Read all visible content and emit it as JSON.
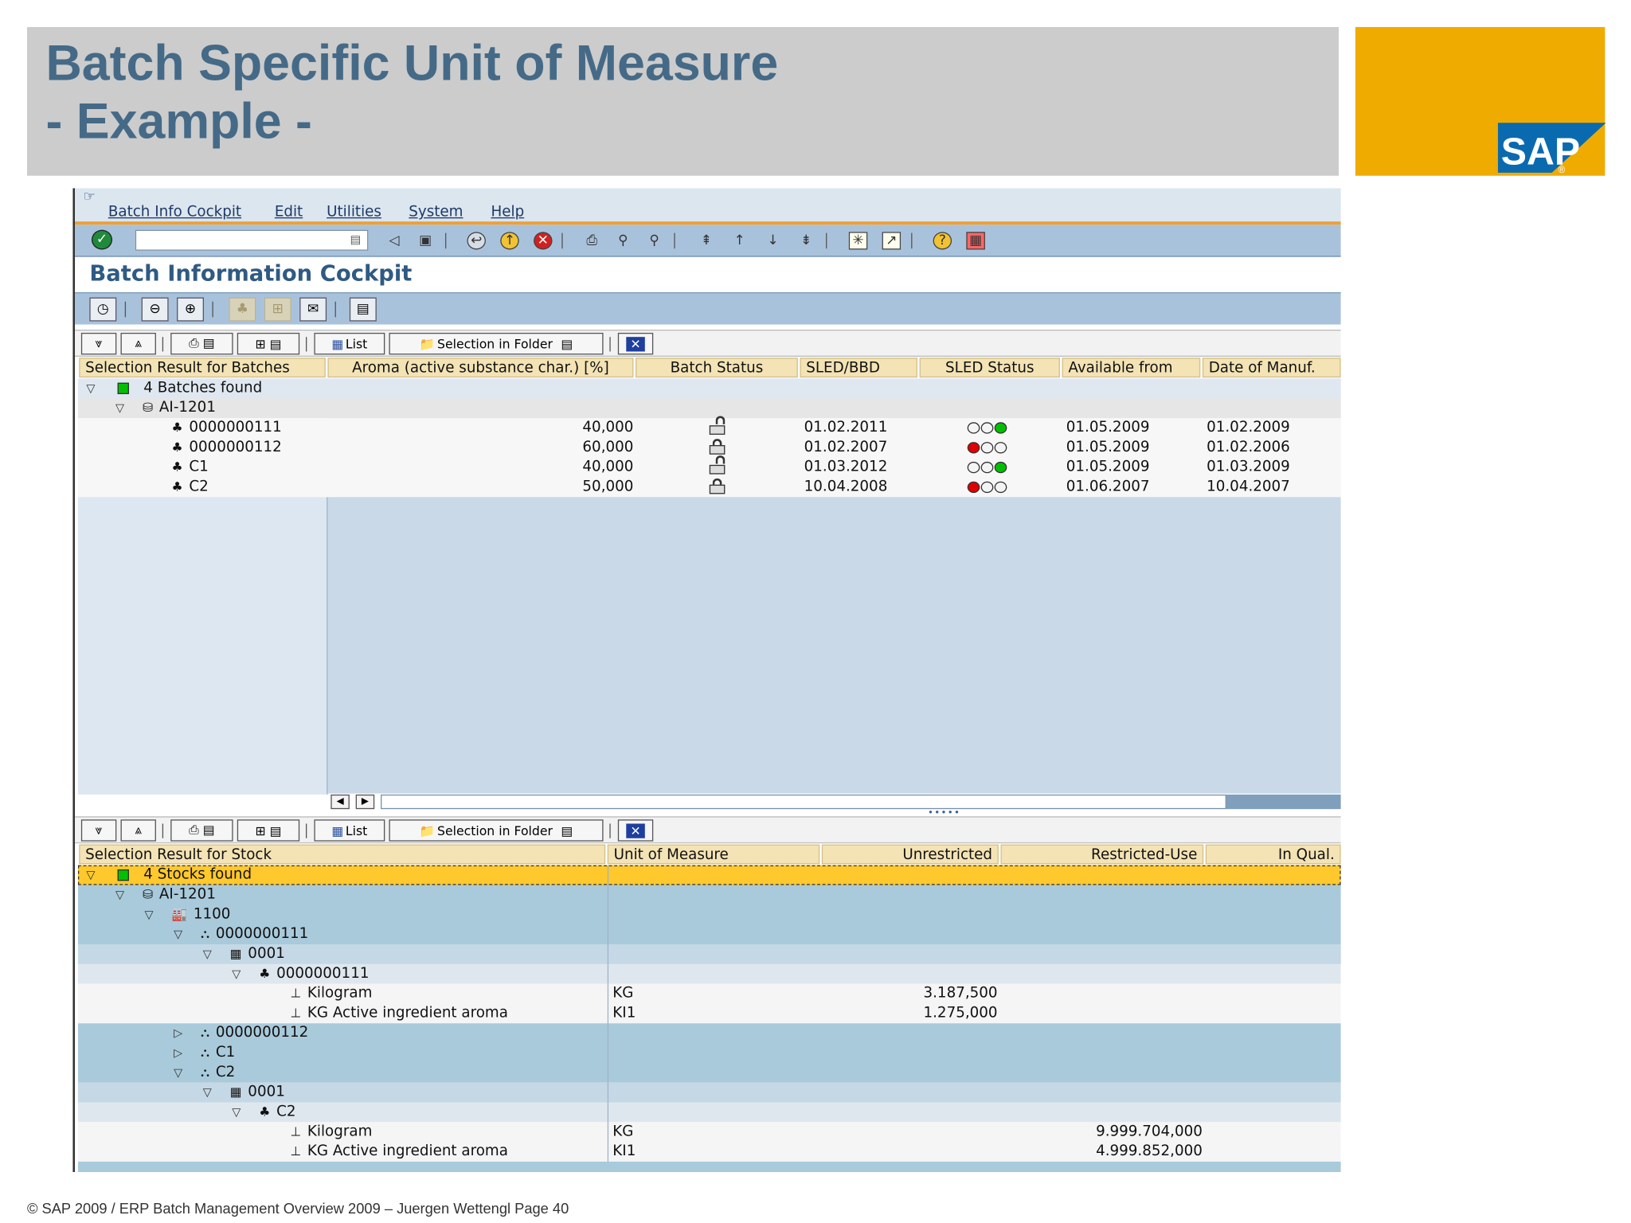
{
  "slide": {
    "title_line1": "Batch Specific Unit of Measure",
    "title_line2": "- Example -",
    "logo_text": "SAP",
    "logo_mark": "®",
    "footer": "© SAP 2009 / ERP Batch Management Overview  2009 – Juergen Wettengl Page 40"
  },
  "menu": {
    "items": [
      "Batch Info Cockpit",
      "Edit",
      "Utilities",
      "System",
      "Help"
    ]
  },
  "screen_title": "Batch Information Cockpit",
  "alv_toolbar": {
    "list_label": "List",
    "folder_label": "Selection in Folder"
  },
  "batches": {
    "headers": [
      "Selection Result for Batches",
      "Aroma (active substance char.) [%]",
      "Batch Status",
      "SLED/BBD",
      "SLED Status",
      "Available from",
      "Date of Manuf."
    ],
    "root_label": "4 Batches found",
    "material_label": "AI-1201",
    "rows": [
      {
        "batch": "0000000111",
        "aroma": "40,000",
        "status": "unrestricted",
        "sled": "01.02.2011",
        "sled_status": "green",
        "available": "01.05.2009",
        "manuf": "01.02.2009"
      },
      {
        "batch": "0000000112",
        "aroma": "60,000",
        "status": "restricted",
        "sled": "01.02.2007",
        "sled_status": "red",
        "available": "01.05.2009",
        "manuf": "01.02.2006"
      },
      {
        "batch": "C1",
        "aroma": "40,000",
        "status": "unrestricted",
        "sled": "01.03.2012",
        "sled_status": "green",
        "available": "01.05.2009",
        "manuf": "01.03.2009"
      },
      {
        "batch": "C2",
        "aroma": "50,000",
        "status": "restricted",
        "sled": "10.04.2008",
        "sled_status": "red",
        "available": "01.06.2007",
        "manuf": "10.04.2007"
      }
    ]
  },
  "stock": {
    "headers": [
      "Selection Result for Stock",
      "Unit of Measure",
      "Unrestricted",
      "Restricted-Use",
      "In Qual."
    ],
    "rows": [
      {
        "label": "4 Stocks found"
      },
      {
        "label": "AI-1201"
      },
      {
        "label": "1100"
      },
      {
        "label": "0000000111"
      },
      {
        "label": "0001"
      },
      {
        "label": "0000000111"
      },
      {
        "label": "Kilogram",
        "uom": "KG",
        "unrestricted": "3.187,500"
      },
      {
        "label": "KG Active ingredient aroma",
        "uom": "KI1",
        "unrestricted": "1.275,000"
      },
      {
        "label": "0000000112"
      },
      {
        "label": "C1"
      },
      {
        "label": "C2"
      },
      {
        "label": "0001"
      },
      {
        "label": "C2"
      },
      {
        "label": "Kilogram",
        "uom": "KG",
        "restricted": "9.999.704,000"
      },
      {
        "label": "KG Active ingredient aroma",
        "uom": "KI1",
        "restricted": "4.999.852,000"
      }
    ]
  },
  "colors": {
    "title_text": "#456a87",
    "sap_gold": "#f0ab00",
    "selected_row": "#ffc82c",
    "tree_blue": "#a9cadb"
  }
}
